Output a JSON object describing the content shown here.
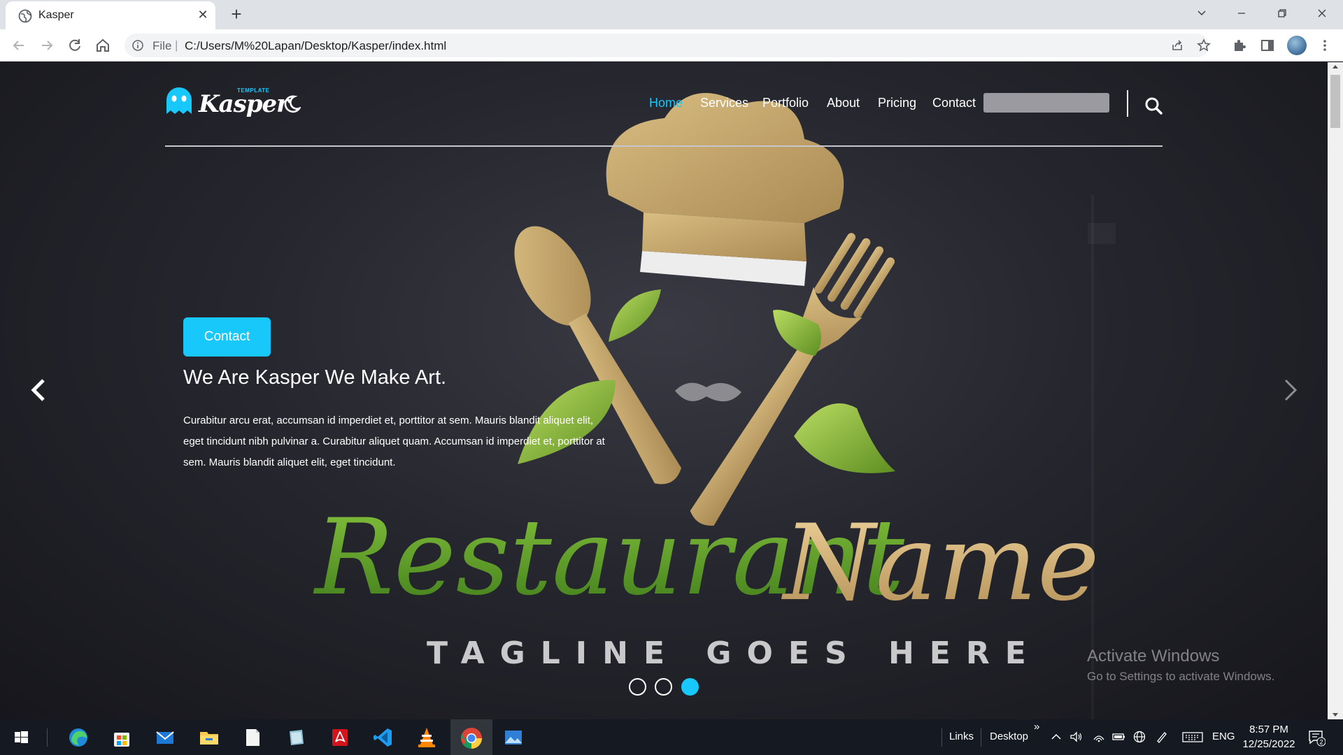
{
  "browser": {
    "tab_title": "Kasper",
    "url_scheme_label": "File",
    "url_separator": "|",
    "url": "C:/Users/M%20Lapan/Desktop/Kasper/index.html"
  },
  "site": {
    "logo_text": "Kasper",
    "logo_subtext": "TEMPLATE",
    "nav": [
      "Home",
      "Services",
      "Portfolio",
      "About",
      "Pricing",
      "Contact"
    ],
    "active_nav": "Home",
    "accent_color": "#19c8fa",
    "hero": {
      "button_label": "Contact",
      "title": "We Are Kasper We Make Art.",
      "text": "Curabitur arcu erat, accumsan id imperdiet et, porttitor at sem. Mauris blandit aliquet elit, eget tincidunt nibh pulvinar a. Curabitur aliquet quam. Accumsan id imperdiet et, porttitor at sem. Mauris blandit aliquet elit, eget tincidunt."
    },
    "background_image": {
      "heading": "Restaurant Name",
      "tagline": "TAGLINE GOES HERE"
    },
    "slider": {
      "slide_count": 3,
      "active_slide": 3
    }
  },
  "watermark": {
    "title": "Activate Windows",
    "subtitle": "Go to Settings to activate Windows."
  },
  "taskbar": {
    "apps": [
      "windows-start",
      "edge",
      "microsoft-store",
      "mail",
      "file-explorer",
      "notepad",
      "sticky-notes",
      "acrobat",
      "vscode",
      "vlc",
      "chrome",
      "photos"
    ],
    "toolbar_links": "Links",
    "toolbar_desktop": "Desktop",
    "overflow": "»",
    "language": "ENG",
    "time": "8:57 PM",
    "date": "12/25/2022",
    "notification_count": "2"
  }
}
